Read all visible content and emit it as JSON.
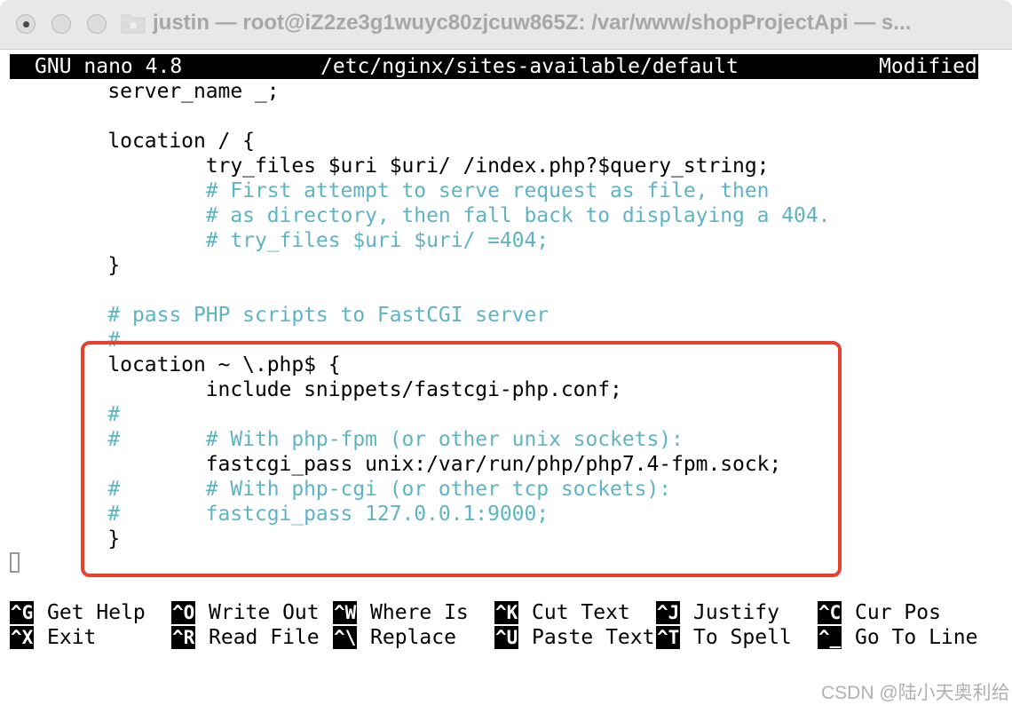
{
  "window": {
    "title": "justin — root@iZ2ze3g1wuyc80zjcuw865Z: /var/www/shopProjectApi — s...",
    "buttons": [
      "close",
      "minimize",
      "zoom"
    ]
  },
  "nano": {
    "app_version": "GNU nano 4.8",
    "file_path": "/etc/nginx/sites-available/default",
    "status": "Modified"
  },
  "editor": {
    "lines": [
      {
        "text": "        server_name _;",
        "type": "code"
      },
      {
        "text": "",
        "type": "code"
      },
      {
        "text": "        location / {",
        "type": "code"
      },
      {
        "text": "                try_files $uri $uri/ /index.php?$query_string;",
        "type": "code"
      },
      {
        "text": "                # First attempt to serve request as file, then",
        "type": "comment"
      },
      {
        "text": "                # as directory, then fall back to displaying a 404.",
        "type": "comment"
      },
      {
        "text": "                # try_files $uri $uri/ =404;",
        "type": "comment"
      },
      {
        "text": "        }",
        "type": "code"
      },
      {
        "text": "",
        "type": "code"
      },
      {
        "text": "        # pass PHP scripts to FastCGI server",
        "type": "comment"
      },
      {
        "text": "        #",
        "type": "comment"
      },
      {
        "text": "        location ~ \\.php$ {",
        "type": "code"
      },
      {
        "text": "                include snippets/fastcgi-php.conf;",
        "type": "code"
      },
      {
        "text": "        #",
        "type": "comment"
      },
      {
        "text": "        #       # With php-fpm (or other unix sockets):",
        "type": "comment"
      },
      {
        "text": "                fastcgi_pass unix:/var/run/php/php7.4-fpm.sock;",
        "type": "code"
      },
      {
        "text": "        #       # With php-cgi (or other tcp sockets):",
        "type": "comment"
      },
      {
        "text": "        #       fastcgi_pass 127.0.0.1:9000;",
        "type": "comment"
      },
      {
        "text": "        }",
        "type": "code"
      }
    ]
  },
  "shortcuts": {
    "row1": [
      {
        "key": "^G",
        "label": "Get Help"
      },
      {
        "key": "^O",
        "label": "Write Out"
      },
      {
        "key": "^W",
        "label": "Where Is"
      },
      {
        "key": "^K",
        "label": "Cut Text"
      },
      {
        "key": "^J",
        "label": "Justify"
      },
      {
        "key": "^C",
        "label": "Cur Pos"
      }
    ],
    "row2": [
      {
        "key": "^X",
        "label": "Exit"
      },
      {
        "key": "^R",
        "label": "Read File"
      },
      {
        "key": "^\\",
        "label": "Replace"
      },
      {
        "key": "^U",
        "label": "Paste Text"
      },
      {
        "key": "^T",
        "label": "To Spell"
      },
      {
        "key": "^_",
        "label": "Go To Line"
      }
    ]
  },
  "watermark": "CSDN @陆小天奥利给",
  "colors": {
    "comment": "#5fb3c5",
    "highlight_box": "#e8412b",
    "title_text": "#a6a6a6"
  }
}
